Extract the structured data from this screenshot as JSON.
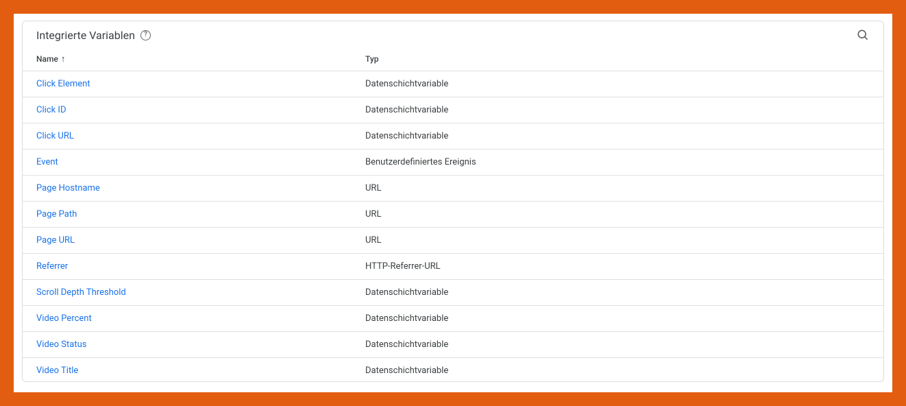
{
  "header": {
    "title": "Integrierte Variablen"
  },
  "columns": {
    "name": "Name",
    "typ": "Typ"
  },
  "rows": [
    {
      "name": "Click Element",
      "typ": "Datenschichtvariable"
    },
    {
      "name": "Click ID",
      "typ": "Datenschichtvariable"
    },
    {
      "name": "Click URL",
      "typ": "Datenschichtvariable"
    },
    {
      "name": "Event",
      "typ": "Benutzerdefiniertes Ereignis"
    },
    {
      "name": "Page Hostname",
      "typ": "URL"
    },
    {
      "name": "Page Path",
      "typ": "URL"
    },
    {
      "name": "Page URL",
      "typ": "URL"
    },
    {
      "name": "Referrer",
      "typ": "HTTP-Referrer-URL"
    },
    {
      "name": "Scroll Depth Threshold",
      "typ": "Datenschichtvariable"
    },
    {
      "name": "Video Percent",
      "typ": "Datenschichtvariable"
    },
    {
      "name": "Video Status",
      "typ": "Datenschichtvariable"
    },
    {
      "name": "Video Title",
      "typ": "Datenschichtvariable"
    }
  ]
}
